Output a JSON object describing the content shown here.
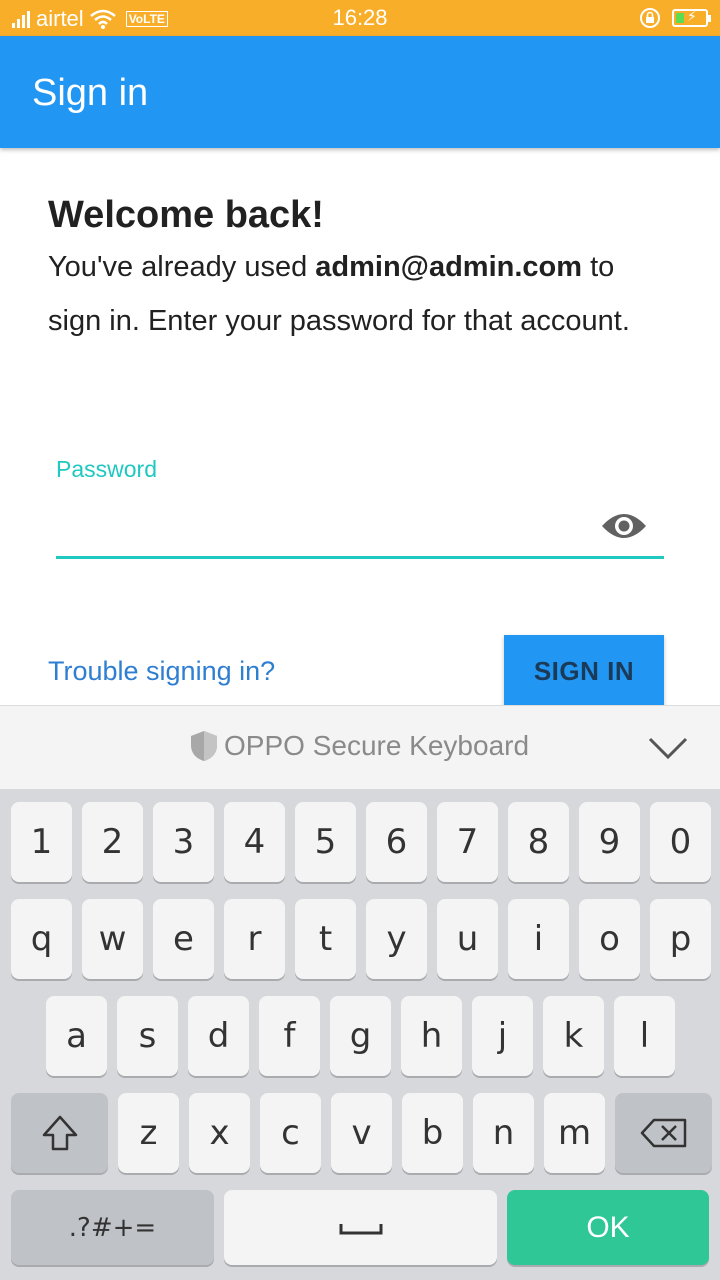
{
  "status_bar": {
    "carrier": "airtel",
    "volte": "VoLTE",
    "time": "16:28"
  },
  "app_bar": {
    "title": "Sign in"
  },
  "content": {
    "welcome": "Welcome back!",
    "message_prefix": "You've already used ",
    "email": "admin@admin.com",
    "message_suffix": " to sign in. Enter your password for that account.",
    "password_label": "Password",
    "password_value": "",
    "trouble_link": "Trouble signing in?",
    "signin_button": "SIGN IN"
  },
  "keyboard": {
    "title": "OPPO Secure Keyboard",
    "row1": [
      "1",
      "2",
      "3",
      "4",
      "5",
      "6",
      "7",
      "8",
      "9",
      "0"
    ],
    "row2": [
      "q",
      "w",
      "e",
      "r",
      "t",
      "y",
      "u",
      "i",
      "o",
      "p"
    ],
    "row3": [
      "a",
      "s",
      "d",
      "f",
      "g",
      "h",
      "j",
      "k",
      "l"
    ],
    "row4": [
      "z",
      "x",
      "c",
      "v",
      "b",
      "n",
      "m"
    ],
    "symbols_label": ".?#+=",
    "ok_label": "OK"
  },
  "colors": {
    "status_bar": "#f9ae29",
    "app_bar": "#2196f3",
    "accent_teal": "#1fc8c0",
    "link": "#2e7ed1",
    "ok_key": "#2ec795"
  }
}
